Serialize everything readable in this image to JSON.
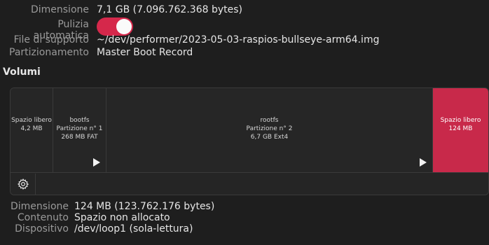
{
  "info": {
    "dimensione_label": "Dimensione",
    "dimensione_value": "7,1 GB (7.096.762.368 bytes)",
    "pulizia_label": "Pulizia automatica",
    "pulizia_on": true,
    "file_label": "File di supporto",
    "file_value": "~/dev/performer/2023-05-03-raspios-bullseye-arm64.img",
    "partizionamento_label": "Partizionamento",
    "partizionamento_value": "Master Boot Record"
  },
  "volumes": {
    "title": "Volumi",
    "segments": [
      {
        "name": "Spazio libero",
        "line2": "4,2 MB",
        "line3": ""
      },
      {
        "name": "bootfs",
        "line2": "Partizione n° 1",
        "line3": "268 MB FAT"
      },
      {
        "name": "rootfs",
        "line2": "Partizione n° 2",
        "line3": "6,7 GB Ext4"
      },
      {
        "name": "Spazio libero",
        "line2": "124 MB",
        "line3": ""
      }
    ],
    "toolbar_icon": "gear-icon",
    "accent_color": "#c8294a"
  },
  "selected": {
    "dimensione_label": "Dimensione",
    "dimensione_value": "124 MB (123.762.176 bytes)",
    "contenuto_label": "Contenuto",
    "contenuto_value": "Spazio non allocato",
    "dispositivo_label": "Dispositivo",
    "dispositivo_value": "/dev/loop1 (sola-lettura)"
  }
}
